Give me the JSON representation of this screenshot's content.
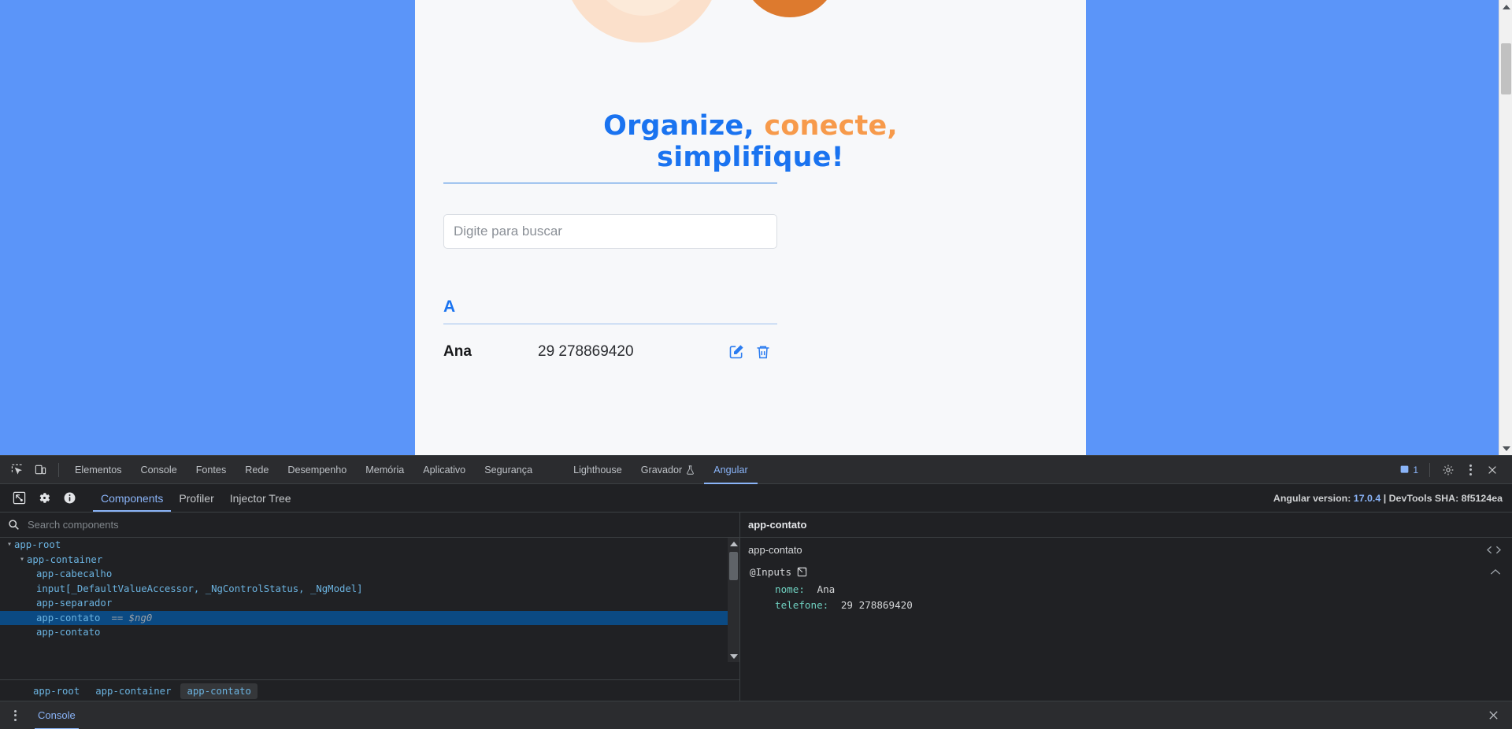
{
  "page": {
    "headline_part1": "Organize,",
    "headline_part2": "conecte,",
    "headline_part3": "simplifique!",
    "accent_blue": "#1a73f0",
    "accent_orange": "#f79a4b",
    "search": {
      "value": "",
      "placeholder": "Digite para buscar"
    },
    "group_letter": "A",
    "contacts": [
      {
        "name": "Ana",
        "phone": "29 278869420"
      }
    ],
    "row_actions": {
      "edit": "edit-icon",
      "delete": "trash-icon"
    }
  },
  "devtools": {
    "tabs": [
      {
        "label": "Elementos",
        "active": false
      },
      {
        "label": "Console",
        "active": false
      },
      {
        "label": "Fontes",
        "active": false
      },
      {
        "label": "Rede",
        "active": false
      },
      {
        "label": "Desempenho",
        "active": false
      },
      {
        "label": "Memória",
        "active": false
      },
      {
        "label": "Aplicativo",
        "active": false
      },
      {
        "label": "Segurança",
        "active": false
      },
      {
        "label": "Lighthouse",
        "active": false
      },
      {
        "label": "Gravador",
        "active": false
      },
      {
        "label": "Angular",
        "active": true
      }
    ],
    "gravador_icon": "flask-icon",
    "issues_count": "1",
    "toolbar_icons": {
      "inspect": "inspect-element-icon",
      "device": "device-toolbar-icon",
      "issues": "issues-panel-icon",
      "settings": "gear-icon",
      "more": "kebab-menu-icon",
      "close": "close-icon"
    }
  },
  "angular": {
    "toolbar_icons": {
      "select": "select-component-icon",
      "settings": "gear-icon",
      "info": "info-icon"
    },
    "tabs": [
      {
        "label": "Components",
        "active": true
      },
      {
        "label": "Profiler",
        "active": false
      },
      {
        "label": "Injector Tree",
        "active": false
      }
    ],
    "version_prefix": "Angular version:",
    "version": "17.0.4",
    "sha_label": "| DevTools SHA: 8f5124ea",
    "search": {
      "value": "",
      "placeholder": "Search components"
    },
    "tree": [
      {
        "label": "app-root",
        "depth": 0,
        "caret": "expanded",
        "selected": false,
        "eq": ""
      },
      {
        "label": "app-container",
        "depth": 1,
        "caret": "expanded",
        "selected": false,
        "eq": ""
      },
      {
        "label": "app-cabecalho",
        "depth": 2,
        "caret": "none",
        "selected": false,
        "eq": ""
      },
      {
        "label": "input[_DefaultValueAccessor, _NgControlStatus, _NgModel]",
        "depth": 2,
        "caret": "none",
        "selected": false,
        "eq": ""
      },
      {
        "label": "app-separador",
        "depth": 2,
        "caret": "none",
        "selected": false,
        "eq": ""
      },
      {
        "label": "app-contato",
        "depth": 2,
        "caret": "none",
        "selected": true,
        "eq": "== $ng0"
      },
      {
        "label": "app-contato",
        "depth": 2,
        "caret": "none",
        "selected": false,
        "eq": ""
      }
    ],
    "breadcrumbs": [
      {
        "label": "app-root",
        "active": false
      },
      {
        "label": "app-container",
        "active": false
      },
      {
        "label": "app-contato",
        "active": true
      }
    ],
    "properties": {
      "header": "app-contato",
      "component": "app-contato",
      "section": "@Inputs",
      "section_icon": "open-external-icon",
      "code_icon": "code-brackets-icon",
      "collapse_icon": "chevron-up-icon",
      "rows": [
        {
          "key": "nome:",
          "value": "Ana"
        },
        {
          "key": "telefone:",
          "value": "29 278869420"
        }
      ]
    }
  },
  "drawer": {
    "menu_icon": "kebab-menu-icon",
    "tab": "Console",
    "close_icon": "close-icon"
  }
}
